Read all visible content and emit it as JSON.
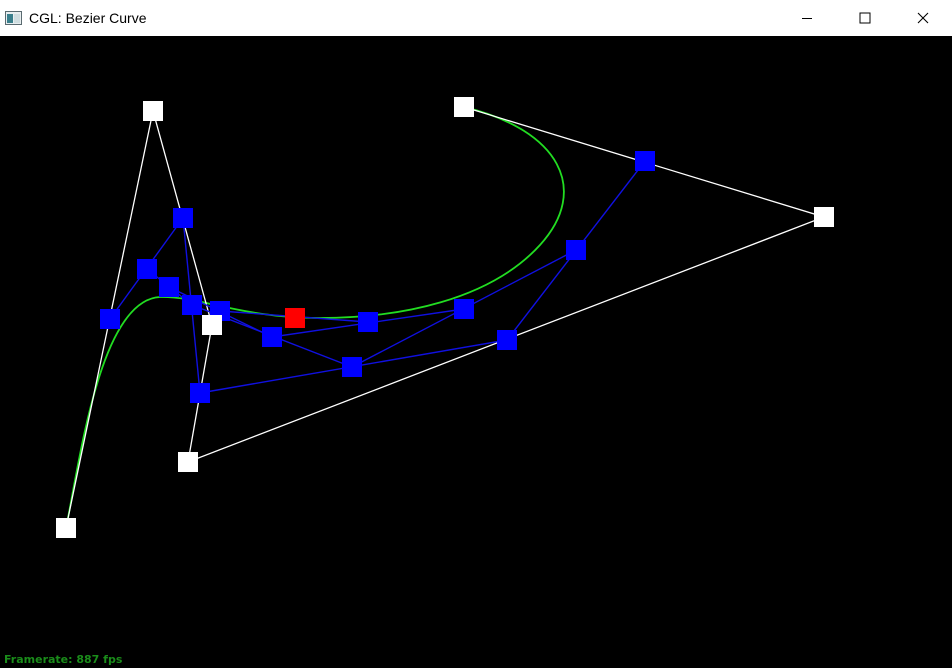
{
  "window": {
    "title": "CGL: Bezier Curve",
    "app_icon": "app-window-icon",
    "controls": [
      "minimize-icon",
      "maximize-icon",
      "close-icon"
    ]
  },
  "status": {
    "framerate_text": "Framerate: 887 fps"
  },
  "colors": {
    "background": "#000000",
    "control_points": "#ffffff",
    "intermediate_points": "#0000ff",
    "evaluated_point": "#ff0000",
    "curve": "#00ff00",
    "framerate_text": "#1a8c1a"
  }
}
